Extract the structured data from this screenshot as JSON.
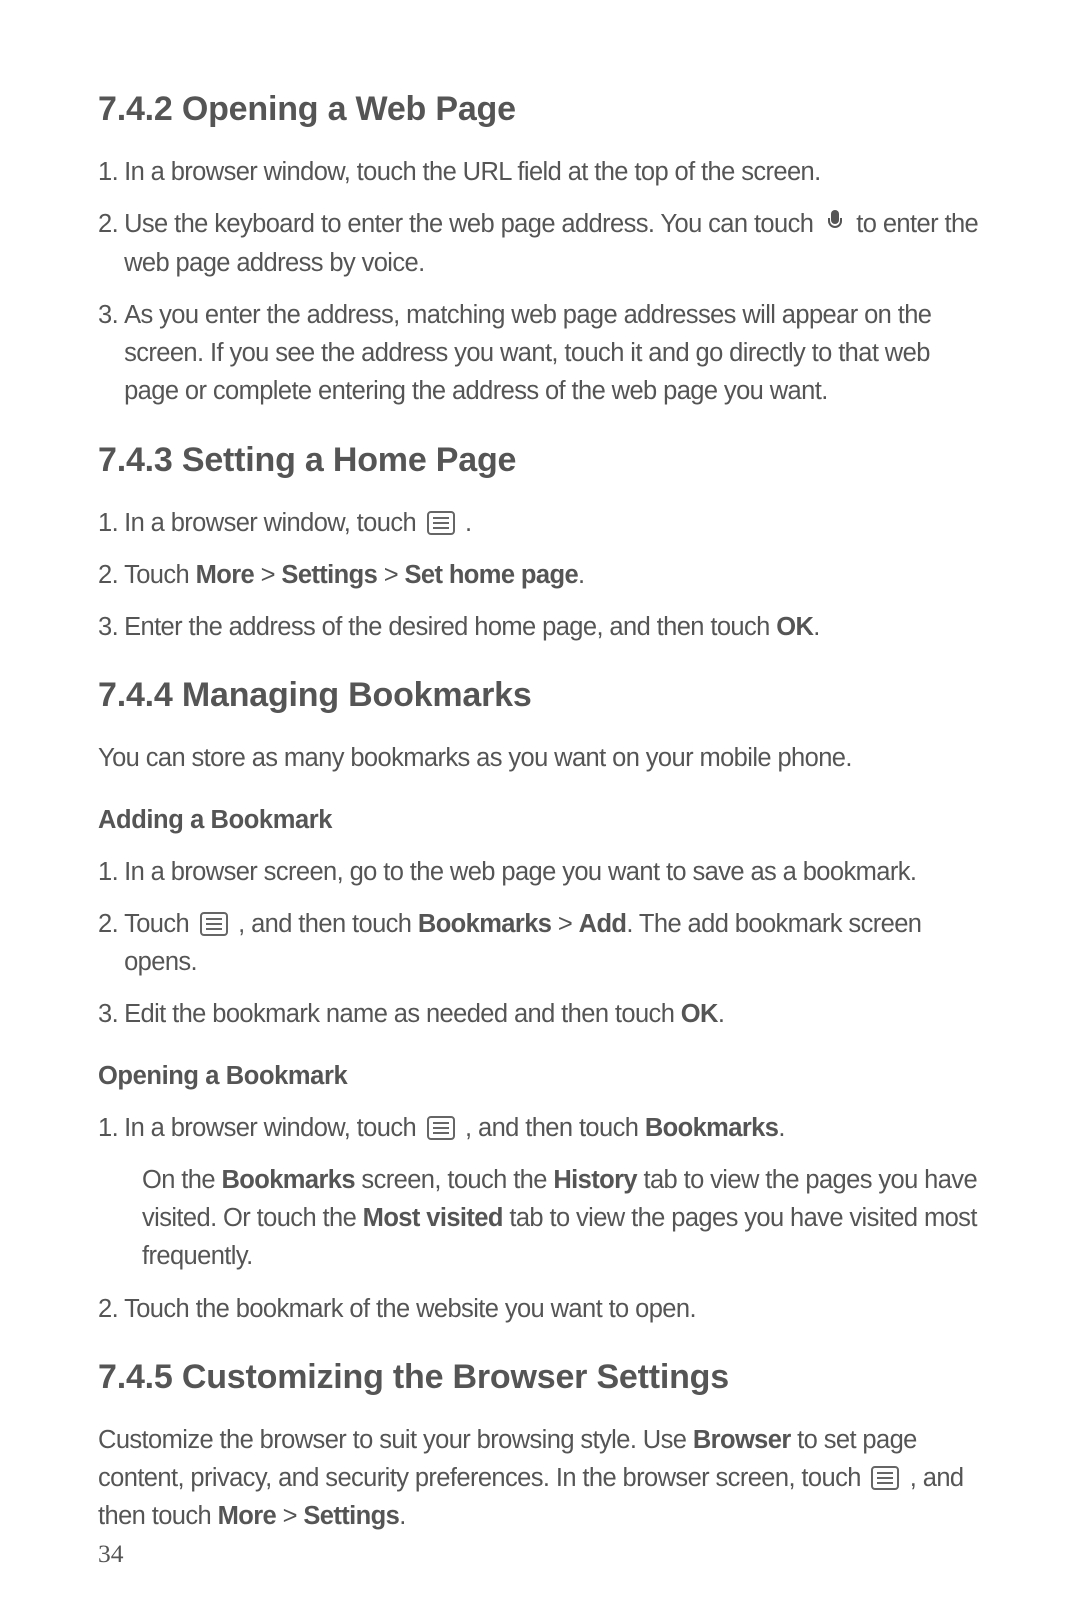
{
  "s742": {
    "heading": "7.4.2  Opening a Web Page",
    "items": [
      {
        "pre": "In a browser window, touch the URL field at the top of the screen."
      },
      {
        "pre": "Use the keyboard to enter the web page address. You can touch ",
        "icon": "mic",
        "post": " to enter the web page address by voice."
      },
      {
        "pre": "As you enter the address, matching web page addresses will appear on the screen. If you see the address you want, touch it and go directly to that web page or complete entering the address of the web page you want."
      }
    ]
  },
  "s743": {
    "heading": "7.4.3  Setting a Home Page",
    "items": [
      {
        "pre": "In a browser window, touch ",
        "icon": "menu",
        "post": " ."
      },
      {
        "runs": [
          {
            "t": "Touch "
          },
          {
            "t": "More",
            "b": true
          },
          {
            "t": " > "
          },
          {
            "t": "Settings",
            "b": true
          },
          {
            "t": " > "
          },
          {
            "t": "Set home page",
            "b": true
          },
          {
            "t": "."
          }
        ]
      },
      {
        "runs": [
          {
            "t": "Enter the address of the desired home page, and then touch "
          },
          {
            "t": "OK",
            "b": true
          },
          {
            "t": "."
          }
        ]
      }
    ]
  },
  "s744": {
    "heading": "7.4.4  Managing Bookmarks",
    "intro": "You can store as many bookmarks as you want on your mobile phone.",
    "sub1": {
      "heading": "Adding a Bookmark",
      "items": [
        {
          "pre": "In a browser screen, go to the web page you want to save as a bookmark."
        },
        {
          "runs_pre": [
            {
              "t": "Touch "
            }
          ],
          "icon": "menu",
          "runs_post": [
            {
              "t": " , and then touch "
            },
            {
              "t": "Bookmarks",
              "b": true
            },
            {
              "t": " > "
            },
            {
              "t": "Add",
              "b": true
            },
            {
              "t": ". The add bookmark screen opens."
            }
          ]
        },
        {
          "runs": [
            {
              "t": "Edit the bookmark name as needed and then touch "
            },
            {
              "t": "OK",
              "b": true
            },
            {
              "t": "."
            }
          ]
        }
      ]
    },
    "sub2": {
      "heading": "Opening a Bookmark",
      "items": [
        {
          "runs_pre": [
            {
              "t": "In a browser window, touch "
            }
          ],
          "icon": "menu",
          "runs_post": [
            {
              "t": " , and then touch "
            },
            {
              "t": "Bookmarks",
              "b": true
            },
            {
              "t": "."
            }
          ],
          "note_runs": [
            {
              "t": "On the "
            },
            {
              "t": "Bookmarks",
              "b": true
            },
            {
              "t": " screen, touch the "
            },
            {
              "t": "History",
              "b": true
            },
            {
              "t": " tab to view the pages you have visited. Or touch the "
            },
            {
              "t": "Most visited",
              "b": true
            },
            {
              "t": " tab to view the pages you have visited most frequently."
            }
          ]
        },
        {
          "pre": "Touch the bookmark of the website you want to open."
        }
      ]
    }
  },
  "s745": {
    "heading": "7.4.5  Customizing the Browser Settings",
    "para": {
      "runs_pre": [
        {
          "t": "Customize the browser to suit your browsing style. Use "
        },
        {
          "t": "Browser",
          "b": true
        },
        {
          "t": " to set page content, privacy, and security preferences. In the browser screen, touch "
        }
      ],
      "icon": "menu",
      "runs_post": [
        {
          "t": " , and then touch "
        },
        {
          "t": "More",
          "b": true
        },
        {
          "t": " > "
        },
        {
          "t": "Settings",
          "b": true
        },
        {
          "t": "."
        }
      ]
    }
  },
  "page_number": "34"
}
